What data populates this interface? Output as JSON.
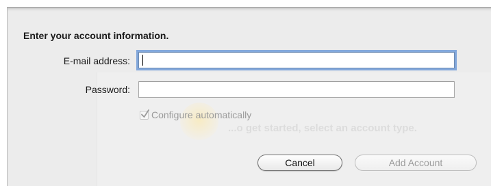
{
  "dialog": {
    "heading": "Enter your account information.",
    "email": {
      "label": "E-mail address:",
      "value": ""
    },
    "password": {
      "label": "Password:",
      "value": ""
    },
    "configure": {
      "label": "Configure automatically",
      "checked": true,
      "enabled": false
    },
    "buttons": {
      "cancel": "Cancel",
      "add_account": "Add Account"
    }
  },
  "background": {
    "ghost_text": "...o get started, select an account type."
  },
  "colors": {
    "focus_ring": "#6092d6",
    "sheet_bg": "#ececec"
  }
}
